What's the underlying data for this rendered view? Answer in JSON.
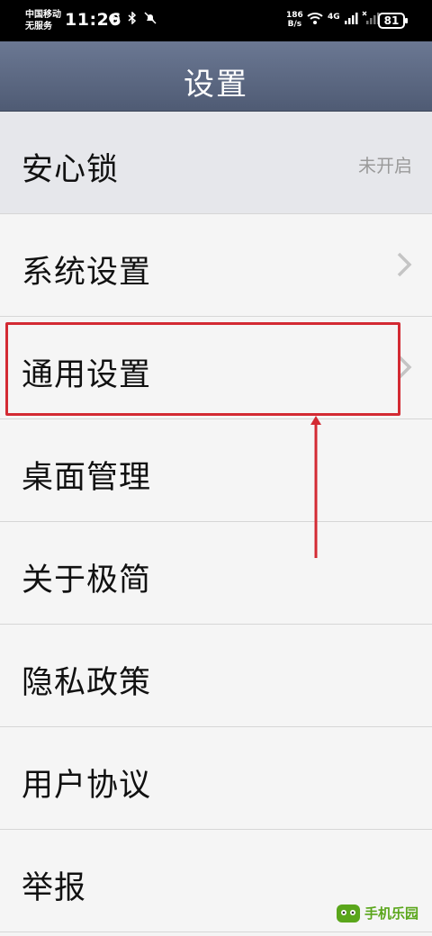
{
  "status_bar": {
    "carrier_line1": "中国移动",
    "carrier_line2": "无服务",
    "time": "11:26",
    "net_speed_value": "186",
    "net_speed_unit": "B/s",
    "network_type": "4G",
    "battery": "81"
  },
  "header": {
    "title": "设置"
  },
  "settings": {
    "items": [
      {
        "label": "安心锁",
        "value": "未开启"
      },
      {
        "label": "系统设置"
      },
      {
        "label": "通用设置"
      },
      {
        "label": "桌面管理"
      },
      {
        "label": "关于极简"
      },
      {
        "label": "隐私政策"
      },
      {
        "label": "用户协议"
      },
      {
        "label": "举报"
      }
    ]
  },
  "annotation": {
    "color": "#d32a33"
  },
  "watermark": {
    "text": "手机乐园",
    "color": "#5aa61b"
  }
}
